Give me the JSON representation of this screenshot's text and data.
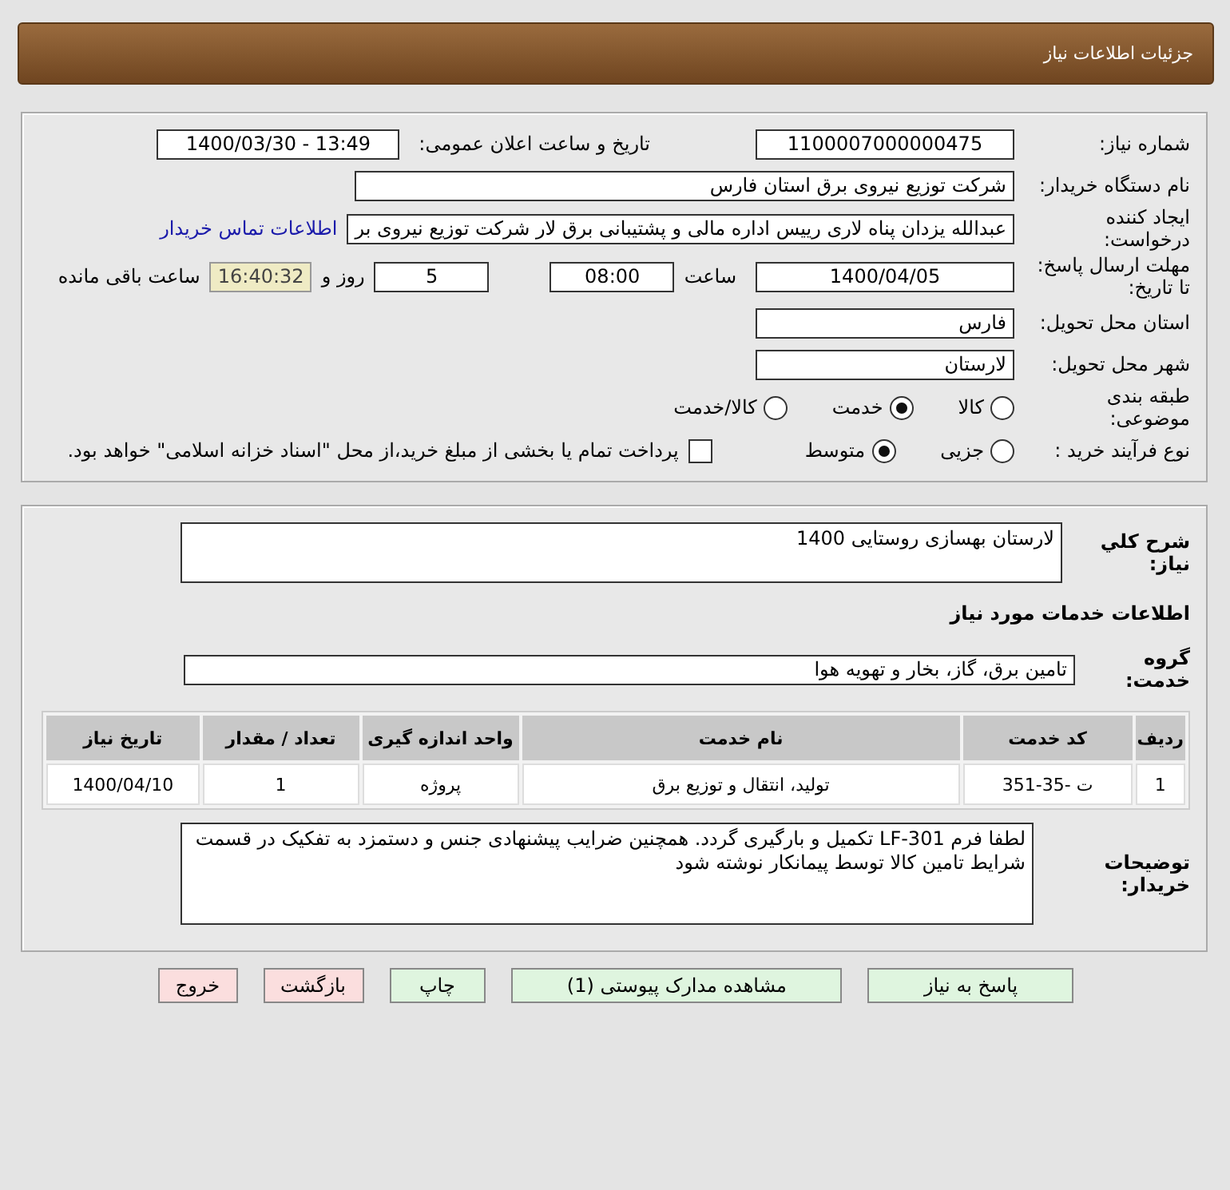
{
  "header": {
    "title": "جزئیات اطلاعات نیاز"
  },
  "details": {
    "need_number_label": "شماره نیاز:",
    "need_number": "1100007000000475",
    "announce_label": "تاریخ و ساعت اعلان عمومی:",
    "announce": "1400/03/30 - 13:49",
    "buyer_label": "نام دستگاه خریدار:",
    "buyer": "شرکت توزیع نیروی برق استان فارس",
    "creator_label": "ایجاد کننده درخواست:",
    "creator": "عبدالله یزدان پناه لاری رییس اداره مالی و پشتیبانی برق لار شرکت توزیع نیروی بر",
    "contact_link": "اطلاعات تماس خریدار",
    "deadline_label": "مهلت ارسال پاسخ: تا تاریخ:",
    "deadline_date": "1400/04/05",
    "time_label": "ساعت",
    "deadline_time": "08:00",
    "days": "5",
    "days_label": "روز و",
    "remaining": "16:40:32",
    "remaining_label": "ساعت باقی مانده",
    "province_label": "استان محل تحویل:",
    "province": "فارس",
    "city_label": "شهر محل تحویل:",
    "city": "لارستان"
  },
  "category": {
    "label": "طبقه بندی موضوعی:",
    "options": [
      {
        "label": "کالا",
        "selected": false
      },
      {
        "label": "خدمت",
        "selected": true
      },
      {
        "label": "کالا/خدمت",
        "selected": false
      }
    ]
  },
  "process": {
    "label": "نوع فرآیند خرید :",
    "options": [
      {
        "label": "جزیی",
        "selected": false
      },
      {
        "label": "متوسط",
        "selected": true
      }
    ],
    "payment": {
      "checked": false,
      "text": "پرداخت تمام یا بخشی از مبلغ خرید،از محل \"اسناد خزانه اسلامی\" خواهد بود."
    }
  },
  "description": {
    "label": "شرح کلي نیاز:",
    "value": "لارستان بهسازی روستایی 1400"
  },
  "services_heading": "اطلاعات خدمات مورد نیاز",
  "service_group": {
    "label": "گروه خدمت:",
    "value": "تامین برق، گاز، بخار و تهویه هوا"
  },
  "table": {
    "columns": [
      "ردیف",
      "کد خدمت",
      "نام خدمت",
      "واحد اندازه گیری",
      "تعداد / مقدار",
      "تاریخ نیاز"
    ],
    "rows": [
      [
        "1",
        "ت -35-351",
        "تولید، انتقال و توزیع برق",
        "پروژه",
        "1",
        "1400/04/10"
      ]
    ]
  },
  "buyer_notes": {
    "label": "توضیحات خریدار:",
    "value": "لطفا فرم LF-301 تکمیل و بارگیری گردد. همچنین ضرایب پیشنهادی جنس و دستمزد به تفکیک در قسمت شرایط تامین کالا توسط پیمانکار نوشته شود"
  },
  "buttons": [
    {
      "label": "پاسخ به نیاز",
      "kind": "primary"
    },
    {
      "label": "مشاهده مدارک پیوستی (1)",
      "kind": "primary"
    },
    {
      "label": "چاپ",
      "kind": "primary"
    },
    {
      "label": "بازگشت",
      "kind": "danger"
    },
    {
      "label": "خروج",
      "kind": "danger"
    }
  ]
}
